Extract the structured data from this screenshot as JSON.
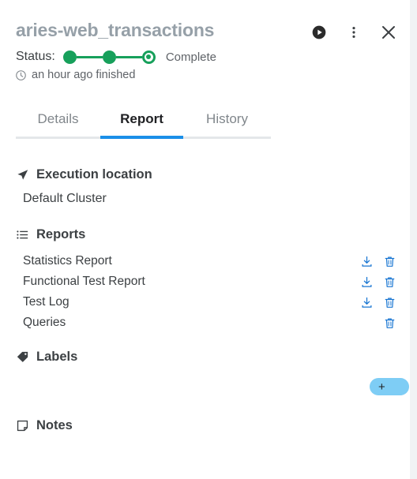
{
  "header": {
    "title": "aries-web_transactions",
    "status_label": "Status:",
    "status_text": "Complete",
    "time_text": "an hour ago finished",
    "clock_icon": "clock-icon",
    "actions": [
      {
        "name": "run-button",
        "icon": "play-circle-icon"
      },
      {
        "name": "more-options-button",
        "icon": "kebab-menu-icon"
      },
      {
        "name": "close-button",
        "icon": "close-icon"
      }
    ],
    "progress": {
      "steps": [
        "complete",
        "complete",
        "current"
      ]
    }
  },
  "tabs": [
    {
      "label": "Details",
      "active": false
    },
    {
      "label": "Report",
      "active": true
    },
    {
      "label": "History",
      "active": false
    }
  ],
  "sections": {
    "execution_location": {
      "title": "Execution location",
      "icon": "navigation-arrow-icon",
      "value": "Default Cluster"
    },
    "reports": {
      "title": "Reports",
      "icon": "list-icon",
      "items": [
        {
          "name": "Statistics Report",
          "download": true,
          "delete": true
        },
        {
          "name": "Functional Test Report",
          "download": true,
          "delete": true
        },
        {
          "name": "Test Log",
          "download": true,
          "delete": true
        },
        {
          "name": "Queries",
          "download": false,
          "delete": true
        }
      ]
    },
    "labels": {
      "title": "Labels",
      "icon": "tag-icon",
      "add_button_label": "+"
    },
    "notes": {
      "title": "Notes",
      "icon": "note-icon"
    }
  },
  "colors": {
    "status_green": "#17a05b",
    "tab_active_blue": "#1a8fe8",
    "action_icon_blue": "#1976d2",
    "add_button_blue": "#7ecdf5",
    "title_gray": "#96a0a8"
  }
}
